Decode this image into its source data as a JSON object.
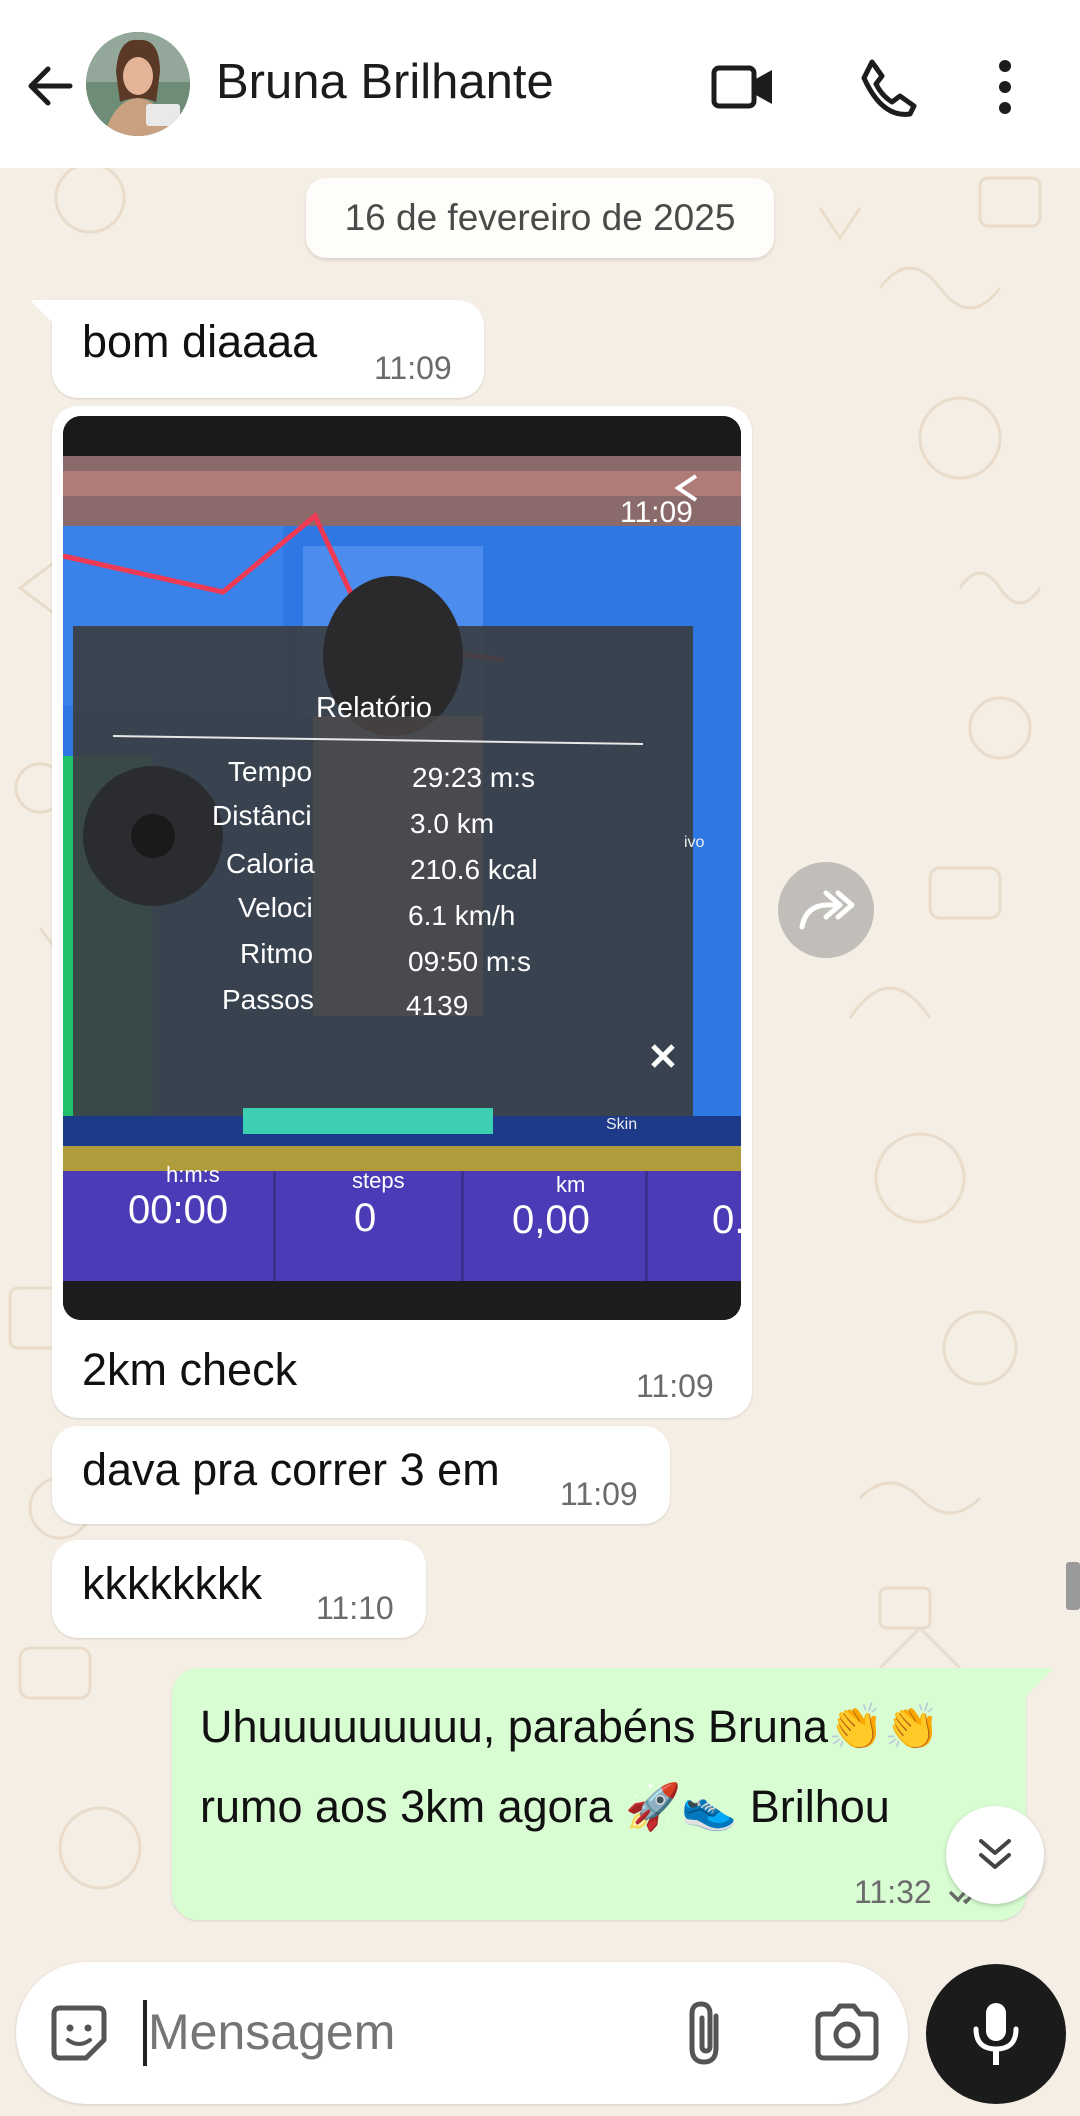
{
  "header": {
    "contact_name": "Bruna Brilhante"
  },
  "date_chip": "16 de fevereiro de 2025",
  "messages": [
    {
      "direction": "in",
      "text": "bom diaaaa",
      "time": "11:09"
    },
    {
      "direction": "in",
      "type": "image",
      "image_time": "11:09",
      "caption": "2km check",
      "time": "11:09"
    },
    {
      "direction": "in",
      "text": "dava pra correr 3 em",
      "time": "11:09"
    },
    {
      "direction": "in",
      "text": "kkkkkkkk",
      "time": "11:10"
    },
    {
      "direction": "out",
      "line1": "Uhuuuuuuuuu, parabéns Bruna👏👏",
      "line2": "rumo aos 3km agora 🚀👟 Brilhou",
      "time": "11:32"
    }
  ],
  "photo": {
    "report_title": "Relatório",
    "rows": [
      {
        "label": "Tempo",
        "value": "29:23 m:s"
      },
      {
        "label": "Distânci",
        "value": "3.0 km"
      },
      {
        "label": "Caloria",
        "value": "210.6 kcal"
      },
      {
        "label": "Veloci",
        "value": "6.1 km/h"
      },
      {
        "label": "Ritmo",
        "value": "09:50 m:s"
      },
      {
        "label": "Passos",
        "value": "4139"
      }
    ],
    "skin_label": "Skin",
    "side_label": "ivo",
    "bottom_stats": [
      {
        "unit": "h:m:s",
        "value": "00:00"
      },
      {
        "unit": "steps",
        "value": "0"
      },
      {
        "unit": "km",
        "value": "0,00"
      },
      {
        "unit": "",
        "value": "0."
      }
    ]
  },
  "composer": {
    "placeholder": "Mensagem"
  },
  "icons": [
    "back-arrow-icon",
    "video-call-icon",
    "phone-icon",
    "more-vert-icon",
    "forward-icon",
    "sticker-icon",
    "attach-icon",
    "camera-icon",
    "mic-icon",
    "double-chevron-down-icon",
    "double-check-icon"
  ],
  "colors": {
    "header_bg": "#ffffff",
    "chat_bg": "#f5eee5",
    "incoming_bubble": "#ffffff",
    "outgoing_bubble": "#d9fdd3",
    "mic_button": "#1b1b1b"
  }
}
